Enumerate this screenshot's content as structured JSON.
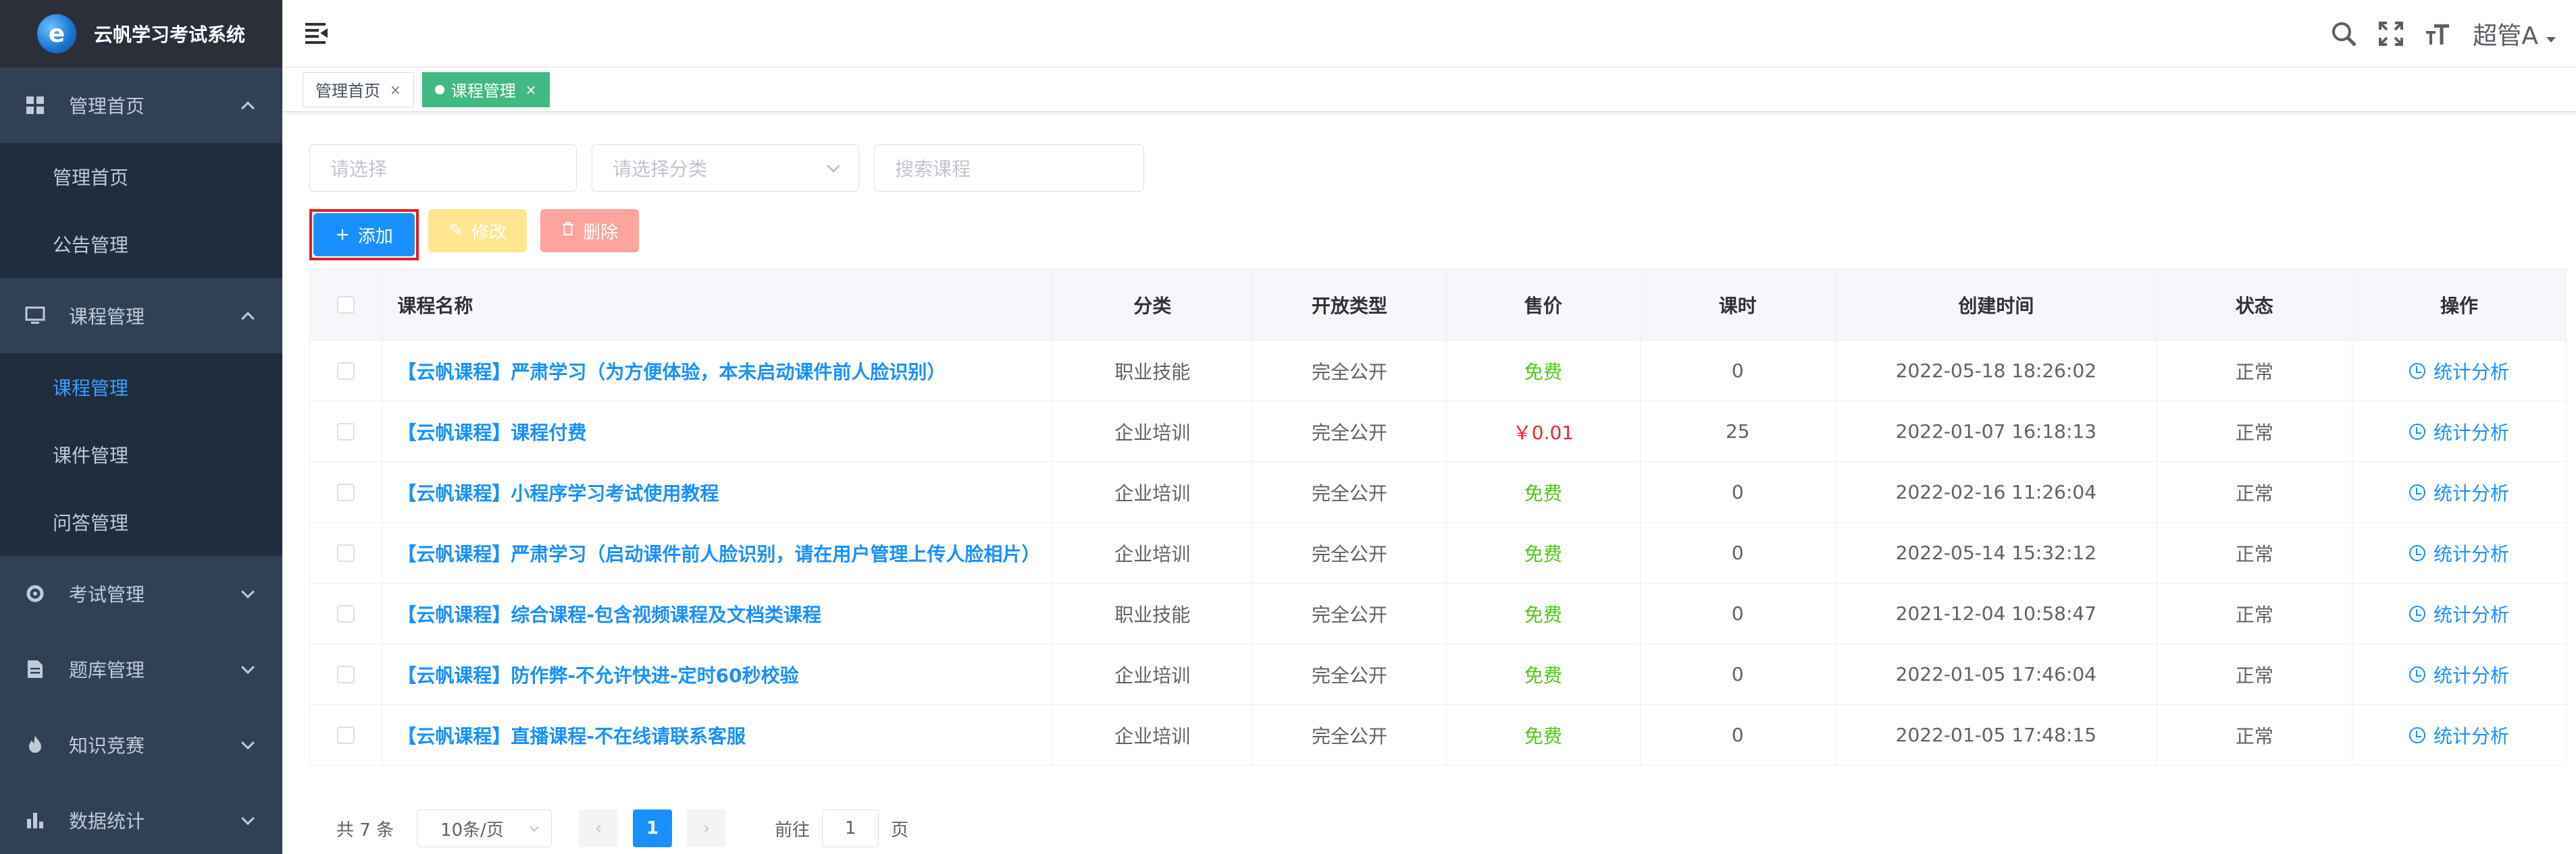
{
  "app": {
    "title": "云帆学习考试系统"
  },
  "sidebar": {
    "groups": [
      {
        "label": "管理首页",
        "icon": "dashboard-icon",
        "expanded": true,
        "items": [
          {
            "label": "管理首页"
          },
          {
            "label": "公告管理"
          }
        ]
      },
      {
        "label": "课程管理",
        "icon": "monitor-icon",
        "expanded": true,
        "items": [
          {
            "label": "课程管理",
            "active": true
          },
          {
            "label": "课件管理"
          },
          {
            "label": "问答管理"
          }
        ]
      },
      {
        "label": "考试管理",
        "icon": "exam-icon",
        "expanded": false,
        "items": []
      },
      {
        "label": "题库管理",
        "icon": "document-icon",
        "expanded": false,
        "items": []
      },
      {
        "label": "知识竞赛",
        "icon": "fire-icon",
        "expanded": false,
        "items": []
      },
      {
        "label": "数据统计",
        "icon": "bar-chart-icon",
        "expanded": false,
        "items": []
      }
    ],
    "active_color": "#409eff",
    "bg_color": "#304156"
  },
  "navbar": {
    "icons": [
      "search-icon",
      "fullscreen-icon",
      "font-size-icon"
    ],
    "user": "超管A"
  },
  "tags": [
    {
      "label": "管理首页",
      "active": false
    },
    {
      "label": "课程管理",
      "active": true
    }
  ],
  "filters": {
    "select1_placeholder": "请选择",
    "select2_placeholder": "请选择分类",
    "search_placeholder": "搜索课程"
  },
  "toolbar": {
    "add_label": "添加",
    "edit_label": "修改",
    "delete_label": "删除"
  },
  "table": {
    "columns": [
      "课程名称",
      "分类",
      "开放类型",
      "售价",
      "课时",
      "创建时间",
      "状态",
      "操作"
    ],
    "rows": [
      {
        "name": "【云帆课程】严肃学习（为方便体验，本未启动课件前人脸识别）",
        "category": "职业技能",
        "open_type": "完全公开",
        "price": "免费",
        "hours": "0",
        "created": "2022-05-18 18:26:02",
        "status": "正常",
        "action": "统计分析"
      },
      {
        "name": "【云帆课程】课程付费",
        "category": "企业培训",
        "open_type": "完全公开",
        "price": "￥0.01",
        "hours": "25",
        "created": "2022-01-07 16:18:13",
        "status": "正常",
        "action": "统计分析"
      },
      {
        "name": "【云帆课程】小程序学习考试使用教程",
        "category": "企业培训",
        "open_type": "完全公开",
        "price": "免费",
        "hours": "0",
        "created": "2022-02-16 11:26:04",
        "status": "正常",
        "action": "统计分析"
      },
      {
        "name": "【云帆课程】严肃学习（启动课件前人脸识别，请在用户管理上传人脸相片）",
        "category": "企业培训",
        "open_type": "完全公开",
        "price": "免费",
        "hours": "0",
        "created": "2022-05-14 15:32:12",
        "status": "正常",
        "action": "统计分析"
      },
      {
        "name": "【云帆课程】综合课程-包含视频课程及文档类课程",
        "category": "职业技能",
        "open_type": "完全公开",
        "price": "免费",
        "hours": "0",
        "created": "2021-12-04 10:58:47",
        "status": "正常",
        "action": "统计分析"
      },
      {
        "name": "【云帆课程】防作弊-不允许快进-定时60秒校验",
        "category": "企业培训",
        "open_type": "完全公开",
        "price": "免费",
        "hours": "0",
        "created": "2022-01-05 17:46:04",
        "status": "正常",
        "action": "统计分析"
      },
      {
        "name": "【云帆课程】直播课程-不在线请联系客服",
        "category": "企业培训",
        "open_type": "完全公开",
        "price": "免费",
        "hours": "0",
        "created": "2022-01-05 17:48:15",
        "status": "正常",
        "action": "统计分析"
      }
    ],
    "free_color": "#52c41a",
    "paid_color": "#f5222d",
    "link_color": "#1890ff"
  },
  "pagination": {
    "total_text": "共 7 条",
    "page_size": "10条/页",
    "current_page": "1",
    "goto_label": "前往",
    "goto_value": "1",
    "page_unit": "页"
  }
}
